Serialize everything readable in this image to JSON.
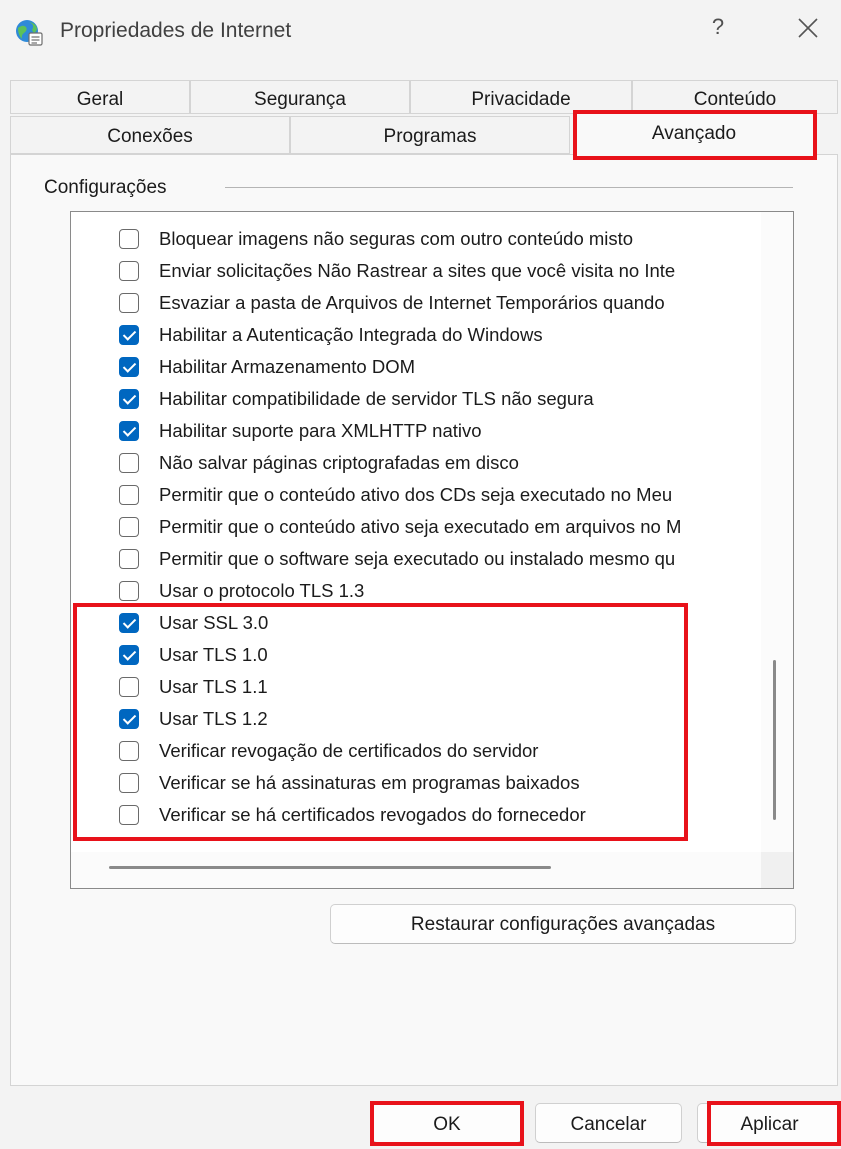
{
  "window": {
    "title": "Propriedades de Internet",
    "help_glyph": "?",
    "close_glyph": "✕"
  },
  "tabs": {
    "row1": [
      "Geral",
      "Segurança",
      "Privacidade",
      "Conteúdo"
    ],
    "row2": [
      "Conexões",
      "Programas",
      "Avançado"
    ],
    "active": "Avançado"
  },
  "settings": {
    "group_label": "Configurações",
    "items": [
      {
        "label": "Bloquear imagens não seguras com outro conteúdo misto",
        "checked": false
      },
      {
        "label": "Enviar solicitações Não Rastrear a sites que você visita no Inte",
        "checked": false
      },
      {
        "label": "Esvaziar a pasta de Arquivos de Internet Temporários quando",
        "checked": false
      },
      {
        "label": "Habilitar a Autenticação Integrada do Windows",
        "checked": true
      },
      {
        "label": "Habilitar Armazenamento DOM",
        "checked": true
      },
      {
        "label": "Habilitar compatibilidade de servidor TLS não segura",
        "checked": true
      },
      {
        "label": "Habilitar suporte para XMLHTTP nativo",
        "checked": true
      },
      {
        "label": "Não salvar páginas criptografadas em disco",
        "checked": false
      },
      {
        "label": "Permitir que o conteúdo ativo dos CDs seja executado no Meu",
        "checked": false
      },
      {
        "label": "Permitir que o conteúdo ativo seja executado em arquivos no M",
        "checked": false
      },
      {
        "label": "Permitir que o software seja executado ou instalado mesmo qu",
        "checked": false
      },
      {
        "label": "Usar o protocolo TLS 1.3",
        "checked": false
      },
      {
        "label": "Usar SSL 3.0",
        "checked": true
      },
      {
        "label": "Usar TLS 1.0",
        "checked": true
      },
      {
        "label": "Usar TLS 1.1",
        "checked": false
      },
      {
        "label": "Usar TLS 1.2",
        "checked": true
      },
      {
        "label": "Verificar revogação de certificados do servidor",
        "checked": false
      },
      {
        "label": "Verificar se há assinaturas em programas baixados",
        "checked": false
      },
      {
        "label": "Verificar se há certificados revogados do fornecedor",
        "checked": false
      }
    ]
  },
  "buttons": {
    "restore": "Restaurar configurações avançadas",
    "ok": "OK",
    "cancel": "Cancelar",
    "apply": "Aplicar"
  },
  "colors": {
    "highlight": "#e8121a",
    "checkbox_checked": "#0067c0"
  }
}
